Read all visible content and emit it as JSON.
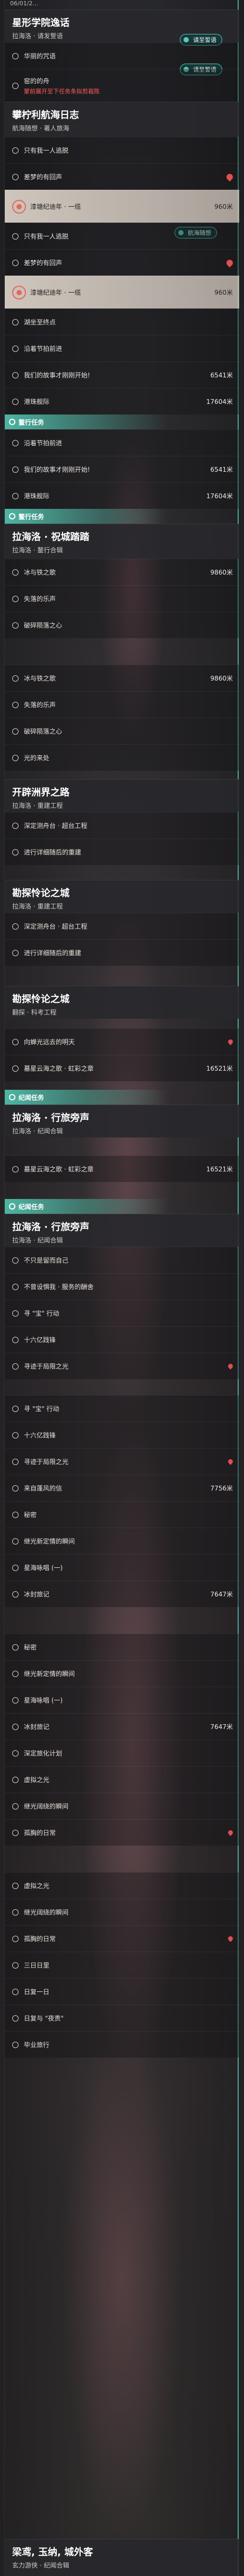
{
  "timestamp": "06/01/2...",
  "blocks": [
    {
      "id": "b1",
      "title": "星形学院逸话",
      "subtitle": "拉海洛 · 请发誓语"
    },
    {
      "id": "b2",
      "title": "攀柠利航海日志",
      "subtitle": "航海随想 · 著人旅海"
    },
    {
      "id": "b3",
      "title": "拉海洛 · 祝城踏踏",
      "subtitle": "拉海洛 · 鳌行合辑"
    },
    {
      "id": "b4",
      "title": "开辟洲界之路",
      "subtitle": "拉海洛 · 重建工程"
    },
    {
      "id": "b5",
      "title": "勘探怜论之城",
      "subtitle": "拉海洛 · 重建工程"
    },
    {
      "id": "b6",
      "title": "勘探怜论之城",
      "subtitle": "翻探 · 科考工程"
    },
    {
      "id": "b7",
      "title": "拉海洛 · 行旅旁声",
      "subtitle": "拉海洛 · 纪闻合辑"
    },
    {
      "id": "b8",
      "title": "拉海洛 · 行旅旁声",
      "subtitle": "拉海洛 · 纪闻合辑"
    },
    {
      "id": "b9",
      "title": "梁鸢, 玉纳, 城外客",
      "subtitle": "玄力游侠 · 纪闻合辑"
    }
  ],
  "pills": {
    "p1": "请至誓语",
    "p2": "请至誓语",
    "p3": "航海随想"
  },
  "banners": {
    "quest1": "鳌行任务",
    "quest2": "鳌行任务",
    "quest3": "纪闻任务",
    "quest4": "纪闻任务"
  },
  "rows": {
    "r1": {
      "label": "华丽的咒语",
      "dist": ""
    },
    "r2": {
      "label": "窑的的舟",
      "note": "蒙前展开至下任务条拟剪裁陈",
      "dist": ""
    },
    "r3": {
      "label": "只有我一人逃脱",
      "dist": ""
    },
    "r4": {
      "label": "差梦的有回声",
      "dist": ""
    },
    "r5": {
      "label": "漆塘纪迪年 · 一缆",
      "dist": "960米"
    },
    "r6": {
      "label": "只有我一人逃脱",
      "dist": ""
    },
    "r7": {
      "label": "差梦的有回声",
      "dist": ""
    },
    "r8": {
      "label": "漆塘纪迪年 · 一缆",
      "dist": "960米"
    },
    "r9": {
      "label": "湖坐至终点",
      "dist": ""
    },
    "r10": {
      "label": "沿着节拍前进",
      "dist": ""
    },
    "r11": {
      "label": "我们的故事才刚刚开始!",
      "dist": "6541米"
    },
    "r12": {
      "label": "港珠舰际",
      "dist": "17604米"
    },
    "r13": {
      "label": "沿着节拍前进",
      "dist": ""
    },
    "r14": {
      "label": "我们的故事才刚刚开始!",
      "dist": "6541米"
    },
    "r15": {
      "label": "港珠舰际",
      "dist": "17604米"
    },
    "r16": {
      "label": "冰与铁之歌",
      "dist": "9860米"
    },
    "r17": {
      "label": "失落的乐声",
      "dist": ""
    },
    "r18": {
      "label": "破碎陨落之心",
      "dist": ""
    },
    "r19": {
      "label": "冰与铁之歌",
      "dist": "9860米"
    },
    "r20": {
      "label": "失落的乐声",
      "dist": ""
    },
    "r21": {
      "label": "破碎陨落之心",
      "dist": ""
    },
    "r22": {
      "label": "光的来处",
      "dist": ""
    },
    "r23": {
      "label": "深定测舟台 · 超台工程",
      "dist": ""
    },
    "r24": {
      "label": "进行详细随后的重建",
      "dist": ""
    },
    "r25": {
      "label": "深定测舟台 · 超台工程",
      "dist": ""
    },
    "r26": {
      "label": "进行详细随后的重建",
      "dist": ""
    },
    "r27": {
      "label": "向蝉光远去的明天",
      "dist": ""
    },
    "r28": {
      "label": "墓星云海之歌 · 虹彩之章",
      "dist": "16521米"
    },
    "r29": {
      "label": "墓星云海之歌 · 虹彩之章",
      "dist": "16521米"
    },
    "r30": {
      "label": "不只是留而自己",
      "dist": ""
    },
    "r31": {
      "label": "不曾设惧我 · 服务的酬舍",
      "dist": ""
    },
    "r32": {
      "label": "寻 \"宝\" 行动",
      "dist": ""
    },
    "r33": {
      "label": "十六亿践锋",
      "dist": ""
    },
    "r34": {
      "label": "寻迹于局限之光",
      "dist": ""
    },
    "r35": {
      "label": "寻 \"宝\" 行动",
      "dist": ""
    },
    "r36": {
      "label": "十六亿践锋",
      "dist": ""
    },
    "r37": {
      "label": "寻迹于局限之光",
      "dist": ""
    },
    "r38": {
      "label": "来自蓬风的信",
      "dist": "7756米"
    },
    "r39": {
      "label": "秘密",
      "dist": ""
    },
    "r40": {
      "label": "继光新定情的瞬间",
      "dist": ""
    },
    "r41": {
      "label": "星海咏唱 (一)",
      "dist": ""
    },
    "r42": {
      "label": "冰封旅记",
      "dist": "7647米"
    },
    "r43": {
      "label": "秘密",
      "dist": ""
    },
    "r44": {
      "label": "继光新定情的瞬间",
      "dist": ""
    },
    "r45": {
      "label": "星海咏唱 (一)",
      "dist": ""
    },
    "r46": {
      "label": "冰封旅记",
      "dist": "7647米"
    },
    "r47": {
      "label": "深定旅化计划",
      "dist": ""
    },
    "r48": {
      "label": "虚拟之光",
      "dist": ""
    },
    "r49": {
      "label": "继光阔绕的瞬间",
      "dist": ""
    },
    "r50": {
      "label": "孤胸的日常",
      "dist": ""
    },
    "r51": {
      "label": "虚拟之光",
      "dist": ""
    },
    "r52": {
      "label": "继光阔绕的瞬间",
      "dist": ""
    },
    "r53": {
      "label": "孤胸的日常",
      "dist": ""
    },
    "r54": {
      "label": "三日日里",
      "dist": ""
    },
    "r55": {
      "label": "日复一日",
      "dist": ""
    },
    "r56": {
      "label": "日复与 \"夜责\"",
      "dist": ""
    },
    "r57": {
      "label": "毕业旅行",
      "dist": ""
    }
  }
}
